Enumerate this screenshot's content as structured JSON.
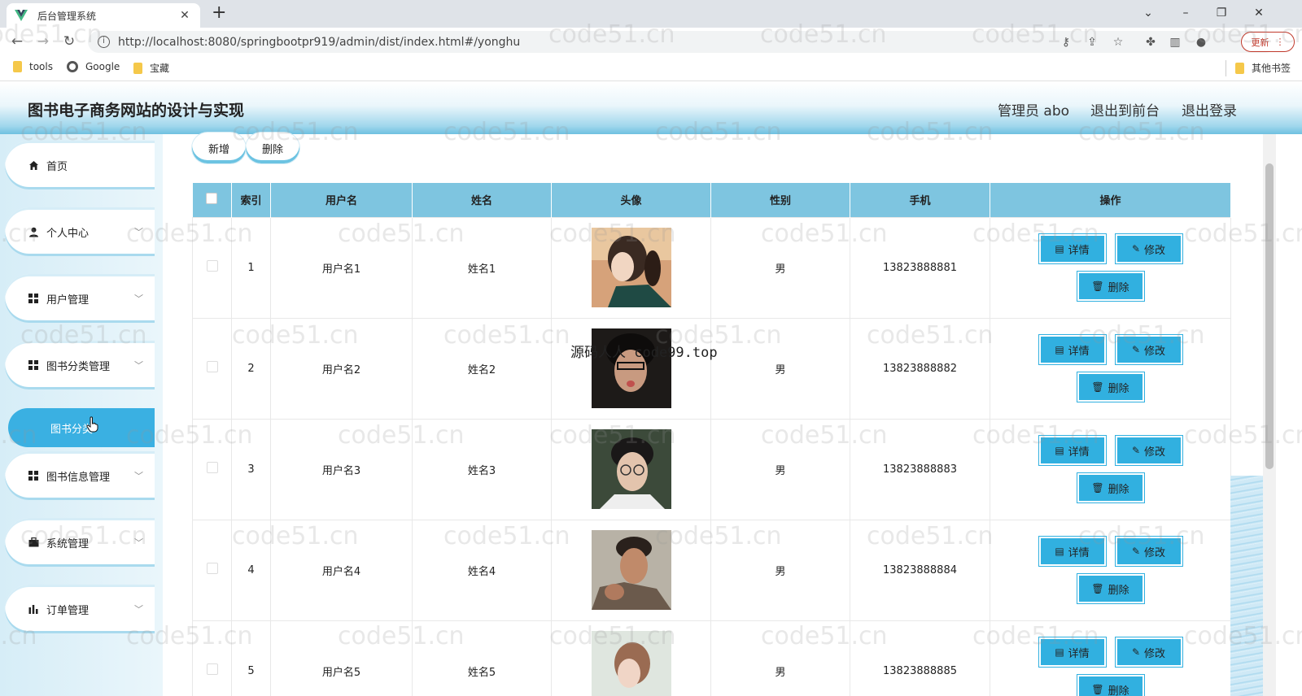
{
  "browser": {
    "tab_title": "后台管理系统",
    "url": "http://localhost:8080/springbootpr919/admin/dist/index.html#/yonghu",
    "update_label": "更新",
    "bookmarks": [
      "tools",
      "Google",
      "宝藏"
    ],
    "other_bookmarks": "其他书签"
  },
  "header": {
    "title": "图书电子商务网站的设计与实现",
    "admin_label": "管理员 abo",
    "front_label": "退出到前台",
    "logout_label": "退出登录"
  },
  "sidebar": {
    "items": [
      {
        "label": "首页",
        "icon": "home-icon"
      },
      {
        "label": "个人中心",
        "icon": "user-icon"
      },
      {
        "label": "用户管理",
        "icon": "grid-icon"
      },
      {
        "label": "图书分类管理",
        "icon": "grid-icon"
      },
      {
        "label": "图书信息管理",
        "icon": "grid-icon"
      },
      {
        "label": "系统管理",
        "icon": "briefcase-icon"
      },
      {
        "label": "订单管理",
        "icon": "bar-chart-icon"
      }
    ],
    "active_sub": "图书分类"
  },
  "actions": {
    "add_label": "新增",
    "delete_label": "删除"
  },
  "table": {
    "columns": [
      "索引",
      "用户名",
      "姓名",
      "头像",
      "性别",
      "手机",
      "操作"
    ],
    "rows": [
      {
        "index": "1",
        "username": "用户名1",
        "name": "姓名1",
        "gender": "男",
        "phone": "13823888881"
      },
      {
        "index": "2",
        "username": "用户名2",
        "name": "姓名2",
        "gender": "男",
        "phone": "13823888882"
      },
      {
        "index": "3",
        "username": "用户名3",
        "name": "姓名3",
        "gender": "男",
        "phone": "13823888883"
      },
      {
        "index": "4",
        "username": "用户名4",
        "name": "姓名4",
        "gender": "男",
        "phone": "13823888884"
      },
      {
        "index": "5",
        "username": "用户名5",
        "name": "姓名5",
        "gender": "男",
        "phone": "13823888885"
      }
    ],
    "detail_label": "详情",
    "edit_label": "修改",
    "delete_label": "删除"
  },
  "watermark": "code51.cn",
  "overlay": "源码人人 code99.top",
  "colors": {
    "accent": "#31b0e0",
    "table_header": "#7ec5e0",
    "active_menu": "#3ab0e2"
  }
}
